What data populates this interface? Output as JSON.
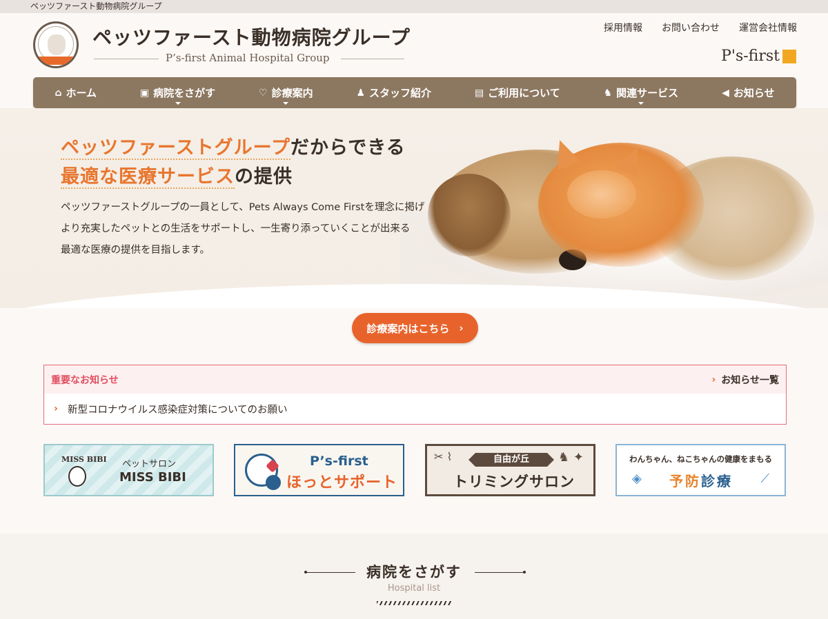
{
  "topbar": {
    "text": "ペッツファースト動物病院グループ"
  },
  "header": {
    "title": "ペッツファースト動物病院グループ",
    "subtitle": "P’s-first Animal Hospital Group",
    "util_links": [
      "採用情報",
      "お問い合わせ",
      "運営会社情報"
    ],
    "brand": "P's-first"
  },
  "nav": {
    "items": [
      {
        "icon": "home-icon",
        "glyph": "⌂",
        "label": "ホーム",
        "dropdown": false
      },
      {
        "icon": "clinic-icon",
        "glyph": "▣",
        "label": "病院をさがす",
        "dropdown": true
      },
      {
        "icon": "stethoscope-icon",
        "glyph": "♡",
        "label": "診療案内",
        "dropdown": true
      },
      {
        "icon": "staff-icon",
        "glyph": "♟",
        "label": "スタッフ紹介",
        "dropdown": false
      },
      {
        "icon": "clipboard-icon",
        "glyph": "▤",
        "label": "ご利用について",
        "dropdown": false
      },
      {
        "icon": "dog-icon",
        "glyph": "♞",
        "label": "関連サービス",
        "dropdown": true
      },
      {
        "icon": "megaphone-icon",
        "glyph": "◀",
        "label": "お知らせ",
        "dropdown": false
      }
    ]
  },
  "hero": {
    "line1_highlight": "ペッツファーストグループ",
    "line1_rest": "だからできる",
    "line2_highlight": "最適な医療サービス",
    "line2_rest": "の提供",
    "body_lines": [
      "ペッツファーストグループの一員として、Pets Always Come Firstを理念に掲げ",
      "より充実したペットとの生活をサポートし、一生寄り添っていくことが出来る",
      "最適な医療の提供を目指します。"
    ]
  },
  "cta": {
    "label": "診療案内はこちら",
    "arrow": "›"
  },
  "notice": {
    "title": "重要なお知らせ",
    "more_label": "お知らせ一覧",
    "items": [
      "新型コロナウイルス感染症対策についてのお願い"
    ]
  },
  "banners": {
    "missbibi": {
      "brand": "MISS BIBI",
      "small": "ペットサロン",
      "large": "MISS BIBI"
    },
    "hotsupport": {
      "line1": "P’s-first",
      "line2": "ほっとサポート"
    },
    "trimming": {
      "tag": "自由が丘",
      "main": "トリミングサロン",
      "tools": "✂ ⌇",
      "pet": "♞ ✦"
    },
    "prevention": {
      "small": "わんちゃん、ねこちゃんの健康をまもる",
      "large_o": "予防",
      "large_b": "診療",
      "pill": "◈",
      "syringe": "⟋"
    }
  },
  "section": {
    "title": "病院をさがす",
    "subtitle": "Hospital list"
  },
  "colors": {
    "accent": "#e8632b",
    "nav_bg": "#8c7760",
    "notice_border": "#e66b7a",
    "text": "#3a2f28"
  }
}
